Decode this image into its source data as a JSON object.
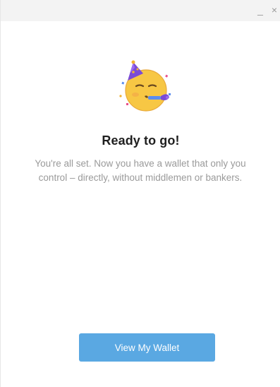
{
  "window": {
    "minimize_glyph": "_",
    "close_glyph": "×"
  },
  "hero": {
    "icon": "party-face-icon"
  },
  "content": {
    "title": "Ready to go!",
    "description": "You're all set. Now you have a wallet that only you control – directly, without middlemen or bankers."
  },
  "actions": {
    "view_wallet_label": "View My Wallet"
  },
  "colors": {
    "accent": "#5aa8e2",
    "title": "#1f1f1f",
    "muted_text": "#9a9a9a",
    "titlebar_bg": "#f3f3f3"
  }
}
